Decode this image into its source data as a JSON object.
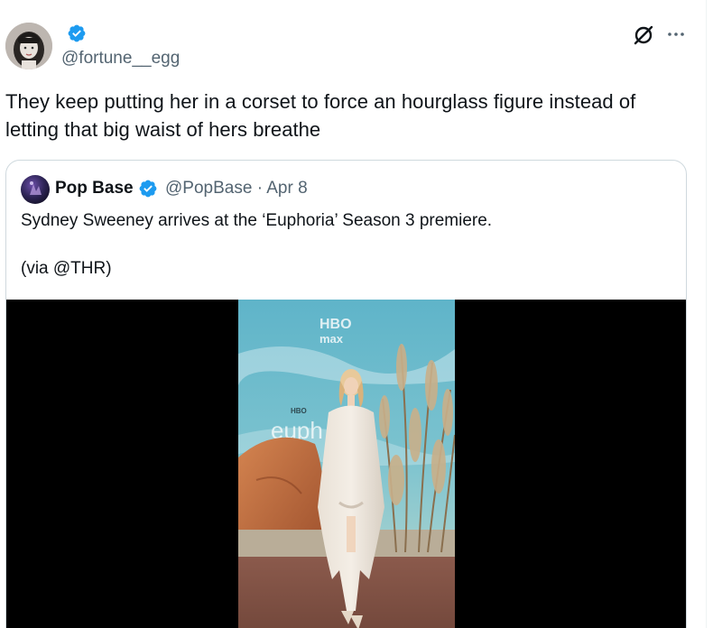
{
  "tweet": {
    "handle": "@fortune__egg",
    "text": "They keep putting her in a corset to force an hourglass figure instead of letting that big waist of hers breathe"
  },
  "quote": {
    "name": "Pop Base",
    "handle": "@PopBase",
    "separator": "·",
    "date": "Apr 8",
    "text": "Sydney Sweeney arrives at the ‘Euphoria’ Season 3 premiere.",
    "via": "(via @THR)",
    "media_texts": {
      "logo_line1": "HBO",
      "logo_line2": "max",
      "small_logo": "HBO",
      "show": "euph"
    }
  },
  "icons": {
    "verified": "verified-badge-icon",
    "grok": "grok-icon",
    "more": "more-options-icon"
  },
  "colors": {
    "verified_blue": "#1d9bf0",
    "secondary_text": "#536471",
    "primary_text": "#0f1419",
    "border": "#cfd9de"
  }
}
